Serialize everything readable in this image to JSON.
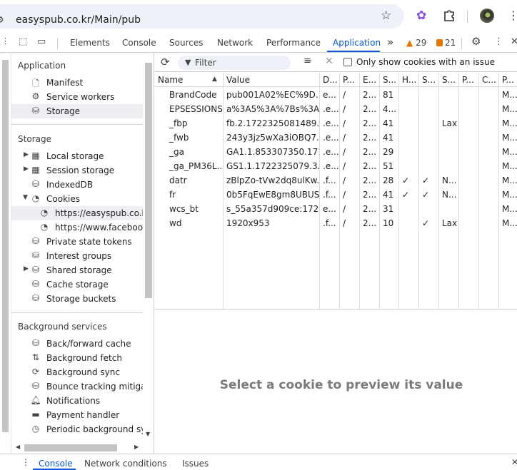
{
  "browser": {
    "url": "easyspub.co.kr/Main/pub"
  },
  "devtools": {
    "tabs": [
      "Elements",
      "Console",
      "Sources",
      "Network",
      "Performance",
      "Application"
    ],
    "active_tab": "Application",
    "more_tabs": "»",
    "warning_count": "29",
    "issue_count": "21"
  },
  "sidebar": {
    "application_title": "Application",
    "application_items": [
      "Manifest",
      "Service workers",
      "Storage"
    ],
    "storage_title": "Storage",
    "storage_items": [
      "Local storage",
      "Session storage",
      "IndexedDB",
      "Cookies",
      "https://easyspub.co.kr",
      "https://www.facebook.com",
      "Private state tokens",
      "Interest groups",
      "Shared storage",
      "Cache storage",
      "Storage buckets"
    ],
    "background_title": "Background services",
    "background_items": [
      "Back/forward cache",
      "Background fetch",
      "Background sync",
      "Bounce tracking mitigations",
      "Notifications",
      "Payment handler",
      "Periodic background sync"
    ]
  },
  "cookies": {
    "filter_placeholder": "Filter",
    "only_issue_label": "Only show cookies with an issue",
    "columns": [
      "Name",
      "Value",
      "D...",
      "P...",
      "E...",
      "S...",
      "H...",
      "S...",
      "S...",
      "P...",
      "C...",
      "P..."
    ],
    "rows": [
      [
        "BrandCode",
        "pub001A02%EC%9D...",
        "e...",
        "/",
        "2...",
        "81",
        "",
        "",
        "",
        "",
        "",
        "M..."
      ],
      [
        "EPSESSIONS",
        "a%3A5%3A%7Bs%3A...",
        ".e...",
        "/",
        "2...",
        "4...",
        "",
        "",
        "",
        "",
        "",
        "M..."
      ],
      [
        "_fbp",
        "fb.2.1722325081489....",
        ".e...",
        "/",
        "2...",
        "41",
        "",
        "",
        "Lax",
        "",
        "",
        "M..."
      ],
      [
        "_fwb",
        "243y3jz5wXa3iOBQ7...",
        ".e...",
        "/",
        "2...",
        "41",
        "",
        "",
        "",
        "",
        "",
        "M..."
      ],
      [
        "_ga",
        "GA1.1.853307350.171...",
        ".e...",
        "/",
        "2...",
        "29",
        "",
        "",
        "",
        "",
        "",
        "M..."
      ],
      [
        "_ga_PM36L...",
        "GS1.1.1722325079.3....",
        ".e...",
        "/",
        "2...",
        "51",
        "",
        "",
        "",
        "",
        "",
        "M..."
      ],
      [
        "datr",
        "zBlpZo-tVw2dq8ulKw...",
        ".f...",
        "/",
        "2...",
        "28",
        "✓",
        "✓",
        "N...",
        "",
        "",
        "M..."
      ],
      [
        "fr",
        "0b5FqEwE8gm8UBUS...",
        ".f...",
        "/",
        "2...",
        "41",
        "✓",
        "✓",
        "N...",
        "",
        "",
        "M..."
      ],
      [
        "wcs_bt",
        "s_55a357d909ce:172...",
        "e...",
        "/",
        "2...",
        "31",
        "",
        "",
        "",
        "",
        "",
        "M..."
      ],
      [
        "wd",
        "1920x953",
        ".f...",
        "/",
        "2...",
        "10",
        "",
        "✓",
        "Lax",
        "",
        "",
        "M..."
      ]
    ],
    "preview_message": "Select a cookie to preview its value"
  },
  "drawer": {
    "tabs": [
      "Console",
      "Network conditions",
      "Issues"
    ],
    "active": "Console"
  }
}
